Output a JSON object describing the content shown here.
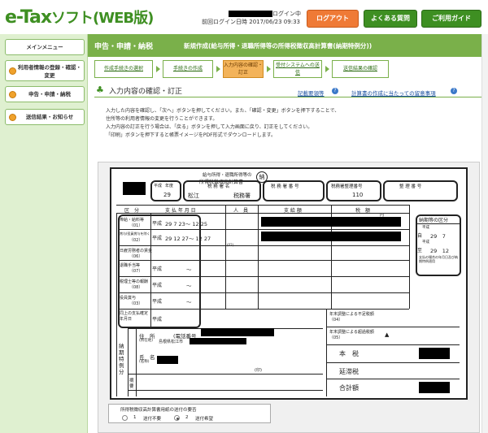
{
  "app": {
    "logo_main": "e-Tax",
    "logo_sub": "ソフト(WEB版)"
  },
  "header": {
    "login_status_suffix": "ログイン中",
    "last_login_label": "前回ログイン日時",
    "last_login_value": "2017/06/23 09:33",
    "logout_label": "ログアウト",
    "faq_label": "よくある質問",
    "guide_label": "ご利用ガイド"
  },
  "sidebar": {
    "items": [
      {
        "label": "メインメニュー"
      },
      {
        "label": "利用者情報の登録・確認・変更"
      },
      {
        "label": "申告・申請・納税"
      },
      {
        "label": "送信結果・お知らせ"
      }
    ]
  },
  "main": {
    "section": "申告・申請・納税",
    "title": "新規作成(給与所得・退職所得等の所得税徴収高計算書(納期特例分))",
    "steps": [
      {
        "label": "作成手続きの選択"
      },
      {
        "label": "手続きの作成"
      },
      {
        "label": "入力内容の確認・訂正"
      },
      {
        "label": "受付システムへの送信"
      },
      {
        "label": "送信結果の確認"
      }
    ],
    "page_heading": "入力内容の確認・訂正",
    "help_link_1": "記載要領等",
    "help_link_2": "計算書の作成に当たっての留意事項",
    "description": [
      "入力した内容を確認し、「次へ」ボタンを押してください。また、「確認・変更」ボタンを押下することで、",
      "住所等の利用者情報の変更を行うことができます。",
      "入力内容の訂正を行う場合は、「戻る」ボタンを押して入力画面に戻り、訂正をしてください。",
      "「印刷」ボタンを押下すると帳票イメージをPDF形式でダウンロードします。"
    ]
  },
  "form": {
    "title_line1": "給与所得・退職所得等の",
    "title_line2": "所得税徴収高計算書",
    "stamp": "納",
    "era_label": "平成",
    "year_label": "年度",
    "year_value": "29",
    "office_label": "税 務 署 名",
    "office_value": "松江",
    "office_suffix": "税務署",
    "taxpayer_no_label": "税 務 署 番 号",
    "ref_no_label": "税務署整理番号",
    "ref_no_value": "110",
    "seiri_label": "整 理 番 号",
    "col_kubun": "区　分",
    "col_period": "支 払 年 月 日",
    "col_people": "人　員",
    "col_amount": "支 給 額",
    "col_tax": "税　額",
    "col_yen": "円",
    "rows": [
      {
        "label": "俸給・給料等",
        "code": "（01）",
        "era": "平成",
        "value": "29  7 23〜 12 25"
      },
      {
        "label": "賞与(役員賞与を除く)",
        "code": "（02）",
        "era": "平成",
        "value": "29 12 27〜 12 27"
      },
      {
        "label": "日雇労務者の賃金",
        "code": "（06）",
        "era": "",
        "value": ""
      },
      {
        "label": "退職手当等",
        "code": "（07）",
        "era": "平成",
        "value": "〜"
      },
      {
        "label": "税理士等の報酬",
        "code": "（08）",
        "era": "平成",
        "value": "〜"
      },
      {
        "label": "役員賞与",
        "code": "（03）",
        "era": "平成",
        "value": "〜"
      },
      {
        "label": "同上の支払確定年月日",
        "code": "",
        "era": "平成",
        "value": ""
      }
    ],
    "nouki_label": "納期等の区分",
    "nouki_from_era": "平成",
    "nouki_from_label": "自",
    "nouki_from_value": "29　7",
    "nouki_to_era": "平成",
    "nouki_to_label": "至",
    "nouki_to_value": "29　12",
    "nouki_note": "支払の場合の年月日及び納期特例適用",
    "address_label": "住　所",
    "address_sub": "(所在地)",
    "address_value": "島根県松江市",
    "phone_label": "(電話番号",
    "name_label": "氏　名",
    "name_sub": "(名称)",
    "seal_label": "(印)",
    "side_label": "納期特例分",
    "memo_label": "摘要",
    "adjust_1": "年末調整による不足税額（04）",
    "adjust_2": "年末調整による超過税額（05）",
    "hon_label": "本　税",
    "entai_label": "延滞税",
    "total_label": "合計額",
    "maru": "㊞",
    "small_marker": "(02)"
  },
  "send_option": {
    "title": "所得税徴収高計算書用紙の送付の要否",
    "opt1_num": "1",
    "opt1_label": "送付不要",
    "opt2_num": "2",
    "opt2_label": "送付希望"
  }
}
